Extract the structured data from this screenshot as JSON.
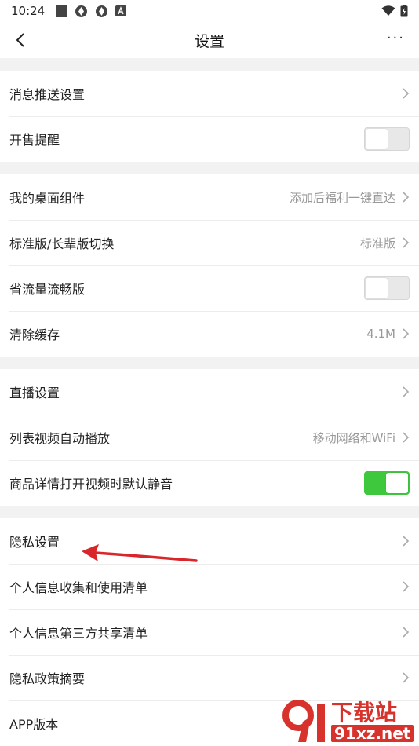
{
  "status_bar": {
    "time": "10:24",
    "icons": [
      "notification-square-icon",
      "app-icon",
      "app-icon",
      "a-icon",
      "wifi-icon",
      "battery-charging-icon"
    ]
  },
  "header": {
    "title": "设置",
    "back_icon": "chevron-left-icon",
    "more_label": "···"
  },
  "groups": [
    [
      {
        "label": "消息推送设置",
        "type": "chevron"
      },
      {
        "label": "开售提醒",
        "type": "toggle",
        "on": false
      }
    ],
    [
      {
        "label": "我的桌面组件",
        "type": "chevron",
        "value": "添加后福利一键直达"
      },
      {
        "label": "标准版/长辈版切换",
        "type": "chevron",
        "value": "标准版"
      },
      {
        "label": "省流量流畅版",
        "type": "toggle",
        "on": false
      },
      {
        "label": "清除缓存",
        "type": "chevron",
        "value": "4.1M"
      }
    ],
    [
      {
        "label": "直播设置",
        "type": "chevron"
      },
      {
        "label": "列表视频自动播放",
        "type": "chevron",
        "value": "移动网络和WiFi"
      },
      {
        "label": "商品详情打开视频时默认静音",
        "type": "toggle",
        "on": true
      }
    ],
    [
      {
        "label": "隐私设置",
        "type": "chevron"
      },
      {
        "label": "个人信息收集和使用清单",
        "type": "chevron"
      },
      {
        "label": "个人信息第三方共享清单",
        "type": "chevron"
      },
      {
        "label": "隐私政策摘要",
        "type": "chevron"
      },
      {
        "label": "APP版本",
        "type": "none"
      }
    ]
  ],
  "colors": {
    "toggle_on": "#3ec83e",
    "annotation_arrow": "#d8262b",
    "watermark": "#d7322c"
  },
  "watermark": {
    "cn": "下载站",
    "en": "91xz.net"
  }
}
